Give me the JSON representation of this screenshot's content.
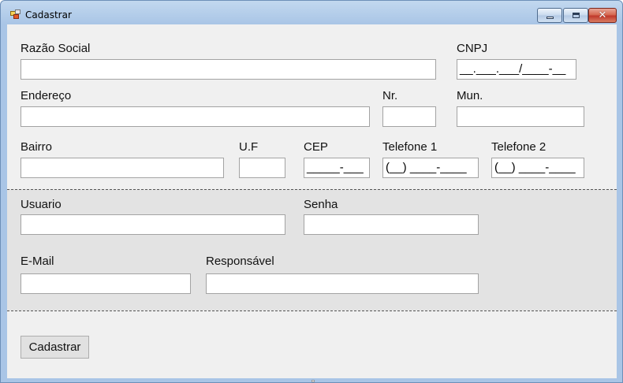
{
  "window": {
    "title": "Cadastrar",
    "close_symbol": "✕"
  },
  "form": {
    "razao_social": {
      "label": "Razão Social",
      "value": ""
    },
    "cnpj": {
      "label": "CNPJ",
      "value": "__.___.___/____-__"
    },
    "endereco": {
      "label": "Endereço",
      "value": ""
    },
    "nr": {
      "label": "Nr.",
      "value": ""
    },
    "mun": {
      "label": "Mun.",
      "value": ""
    },
    "bairro": {
      "label": "Bairro",
      "value": ""
    },
    "uf": {
      "label": "U.F",
      "value": ""
    },
    "cep": {
      "label": "CEP",
      "value": "_____-___"
    },
    "telefone1": {
      "label": "Telefone 1",
      "value": "(__) ____-____"
    },
    "telefone2": {
      "label": "Telefone 2",
      "value": "(__) ____-____"
    },
    "usuario": {
      "label": "Usuario",
      "value": ""
    },
    "senha": {
      "label": "Senha",
      "value": ""
    },
    "email": {
      "label": "E-Mail",
      "value": ""
    },
    "responsavel": {
      "label": "Responsável",
      "value": ""
    }
  },
  "actions": {
    "submit_label": "Cadastrar"
  },
  "icons": {
    "app": "form-app-icon",
    "minimize": "minimize-icon",
    "maximize": "maximize-icon",
    "close": "close-icon"
  }
}
